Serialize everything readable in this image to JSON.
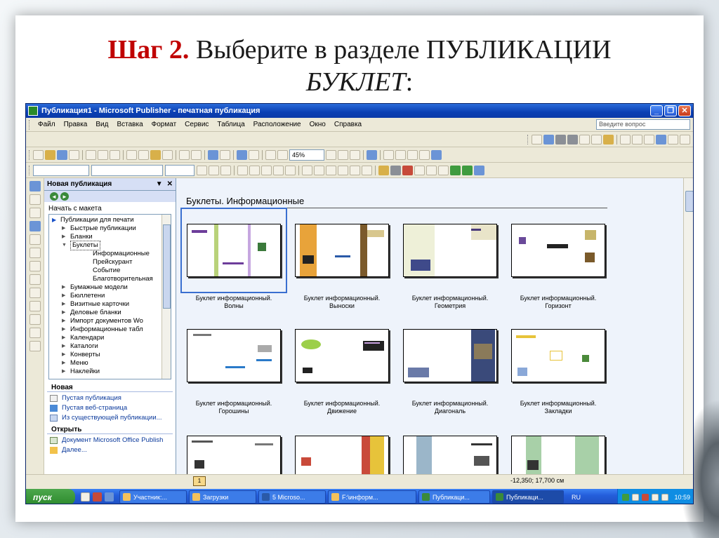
{
  "slide": {
    "title_step": "Шаг 2.",
    "title_rest": " Выберите в разделе ПУБЛИКАЦИИ",
    "title_line2": "БУКЛЕТ",
    "title_colon": ":",
    "accent_color": "#c00000"
  },
  "window": {
    "title": "Публикация1 - Microsoft Publisher - печатная публикация",
    "minimize_icon": "minimize-icon",
    "maximize_icon": "maximize-icon",
    "close_icon": "close-icon"
  },
  "menu": {
    "items": [
      "Файл",
      "Правка",
      "Вид",
      "Вставка",
      "Формат",
      "Сервис",
      "Таблица",
      "Расположение",
      "Окно",
      "Справка"
    ],
    "help_placeholder": "Введите вопрос"
  },
  "toolbar": {
    "zoom": "45%"
  },
  "task_pane": {
    "title": "Новая публикация",
    "section_start": "Начать с макета",
    "tree": [
      {
        "label": "Публикации для печати",
        "level": 0,
        "expanded": true
      },
      {
        "label": "Быстрые публикации",
        "level": 1
      },
      {
        "label": "Бланки",
        "level": 1
      },
      {
        "label": "Буклеты",
        "level": 1,
        "expanded": true,
        "selected": true
      },
      {
        "label": "Информационные",
        "level": 2
      },
      {
        "label": "Прейскурант",
        "level": 2
      },
      {
        "label": "Событие",
        "level": 2
      },
      {
        "label": "Благотворительная",
        "level": 2
      },
      {
        "label": "Бумажные модели",
        "level": 1
      },
      {
        "label": "Бюллетени",
        "level": 1
      },
      {
        "label": "Визитные карточки",
        "level": 1
      },
      {
        "label": "Деловые бланки",
        "level": 1
      },
      {
        "label": "Импорт документов Wo",
        "level": 1
      },
      {
        "label": "Информационные табл",
        "level": 1
      },
      {
        "label": "Календари",
        "level": 1
      },
      {
        "label": "Каталоги",
        "level": 1
      },
      {
        "label": "Конверты",
        "level": 1
      },
      {
        "label": "Меню",
        "level": 1
      },
      {
        "label": "Наклейки",
        "level": 1
      }
    ],
    "group_new": "Новая",
    "new_links": [
      "Пустая публикация",
      "Пустая веб-страница",
      "Из существующей публикации..."
    ],
    "group_open": "Открыть",
    "open_links": [
      "Документ Microsoft Office Publish",
      "Далее..."
    ]
  },
  "gallery": {
    "heading": "Буклеты. Информационные",
    "cards": [
      {
        "label1": "Буклет информационный.",
        "label2": "Волны"
      },
      {
        "label1": "Буклет информационный.",
        "label2": "Выноски"
      },
      {
        "label1": "Буклет информационный.",
        "label2": "Геометрия"
      },
      {
        "label1": "Буклет информационный.",
        "label2": "Горизонт"
      },
      {
        "label1": "Буклет информационный.",
        "label2": "Горошины"
      },
      {
        "label1": "Буклет информационный.",
        "label2": "Движение"
      },
      {
        "label1": "Буклет информационный.",
        "label2": "Диагональ"
      },
      {
        "label1": "Буклет информационный.",
        "label2": "Закладки"
      },
      {
        "label1": "",
        "label2": ""
      },
      {
        "label1": "",
        "label2": ""
      },
      {
        "label1": "",
        "label2": ""
      },
      {
        "label1": "",
        "label2": ""
      }
    ]
  },
  "status": {
    "page_number": "1",
    "coordinates": "-12,350; 17,700 см"
  },
  "taskbar": {
    "start": "пуск",
    "buttons": [
      "Участник:...",
      "Загрузки",
      "5 Microso...",
      "F:\\информ...",
      "Публикаци...",
      "Публикаци..."
    ],
    "lang": "RU",
    "clock": "10:59"
  }
}
